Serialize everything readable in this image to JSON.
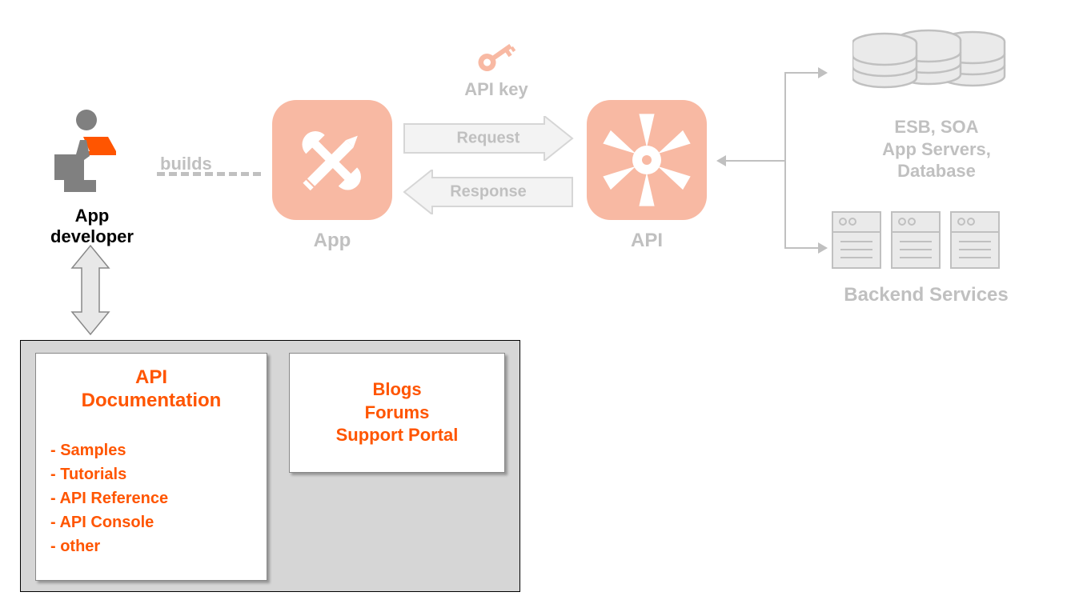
{
  "developer": {
    "label": "App developer"
  },
  "builds": {
    "label": "builds"
  },
  "app": {
    "label": "App"
  },
  "api_key": {
    "label": "API key"
  },
  "request": {
    "label": "Request"
  },
  "response": {
    "label": "Response"
  },
  "api": {
    "label": "API"
  },
  "backend": {
    "db_label": "ESB, SOA\nApp Servers,\nDatabase",
    "label": "Backend Services"
  },
  "docs": {
    "title": "API\nDocumentation",
    "items": [
      "- Samples",
      "- Tutorials",
      "- API Reference",
      "- API Console",
      "- other"
    ]
  },
  "docs2": {
    "lines": [
      "Blogs",
      "Forums",
      "Support Portal"
    ]
  },
  "colors": {
    "accent": "#ff5500",
    "faded": "#c0c0c0",
    "app_bg": "#f8b9a3"
  }
}
